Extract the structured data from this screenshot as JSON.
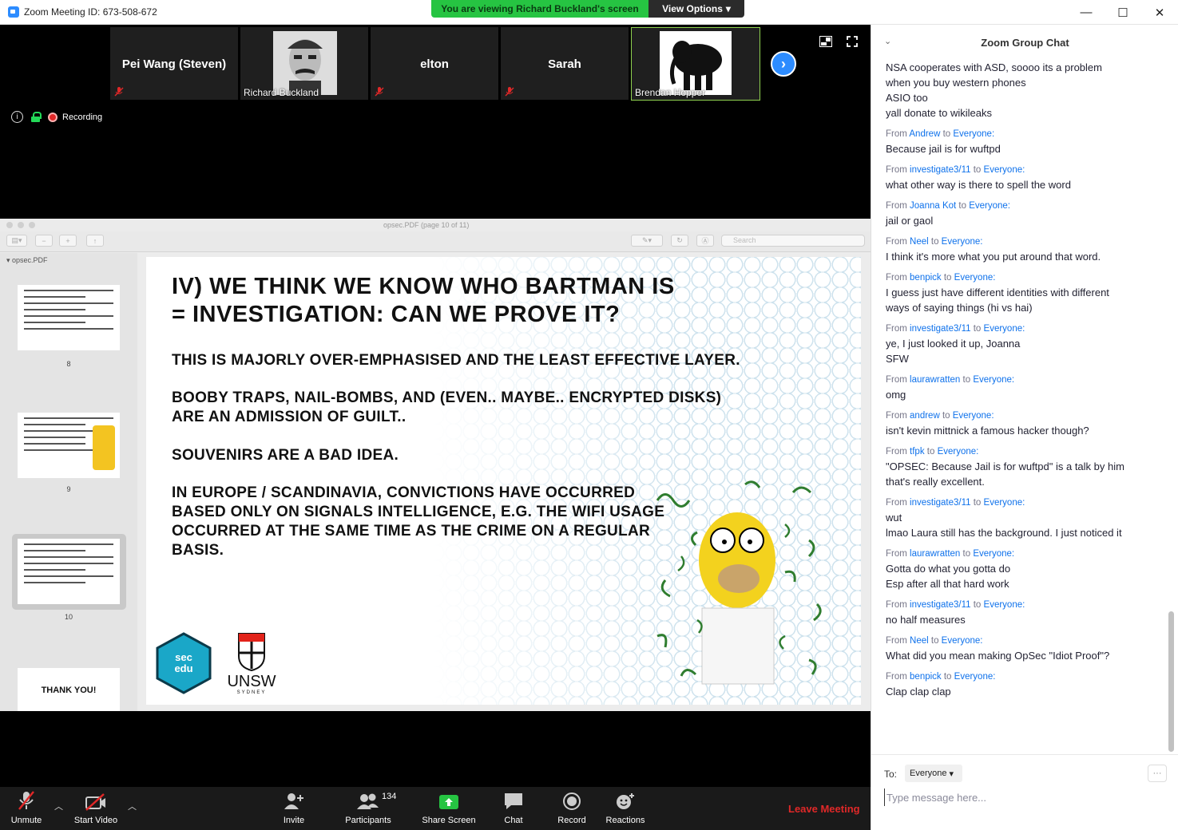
{
  "window": {
    "title": "Zoom Meeting ID: 673-508-672"
  },
  "banner": {
    "viewing": "You are viewing Richard Buckland's screen",
    "view_options": "View Options"
  },
  "participants_strip": [
    {
      "name": "Pei Wang (Steven)",
      "muted": true,
      "video": false
    },
    {
      "name": "Richard Buckland",
      "muted": false,
      "video": true
    },
    {
      "name": "elton",
      "muted": true,
      "video": false
    },
    {
      "name": "Sarah",
      "muted": true,
      "video": false
    },
    {
      "name": "Brendan Hopper",
      "muted": false,
      "video": true,
      "active": true
    }
  ],
  "status": {
    "recording": "Recording"
  },
  "pdf": {
    "title": "opsec.PDF (page 10 of 11)",
    "sidebar_file": "opsec.PDF",
    "search_placeholder": "Search",
    "thumb_pages": [
      "8",
      "9",
      "10"
    ],
    "last_thumb_text": "THANK YOU!",
    "slide": {
      "title_line1": "IV) WE THINK WE KNOW WHO BARTMAN IS",
      "title_line2": "= INVESTIGATION: CAN WE PROVE IT?",
      "p1": "THIS IS MAJORLY OVER-EMPHASISED AND THE LEAST EFFECTIVE LAYER.",
      "p2a": "BOOBY TRAPS, NAIL-BOMBS, AND (EVEN.. MAYBE.. ENCRYPTED DISKS)",
      "p2b": "ARE AN ADMISSION OF GUILT..",
      "p3": "SOUVENIRS ARE A BAD IDEA.",
      "p4a": "IN EUROPE / SCANDINAVIA, CONVICTIONS HAVE OCCURRED",
      "p4b": "BASED ONLY ON SIGNALS INTELLIGENCE, E.G. THE WIFI USAGE",
      "p4c": "OCCURRED AT THE SAME TIME AS THE CRIME ON A REGULAR",
      "p4d": "BASIS.",
      "logo_sec": "sec edu",
      "logo_unsw": "UNSW",
      "logo_unsw_sub": "SYDNEY"
    }
  },
  "toolbar": {
    "unmute": "Unmute",
    "start_video": "Start Video",
    "invite": "Invite",
    "participants": "Participants",
    "participants_count": "134",
    "share_screen": "Share Screen",
    "chat": "Chat",
    "record": "Record",
    "reactions": "Reactions",
    "leave": "Leave Meeting"
  },
  "chat": {
    "title": "Zoom Group Chat",
    "to_label": "To:",
    "to_value": "Everyone",
    "placeholder": "Type message here...",
    "intro_lines": [
      "NSA cooperates with ASD, soooo its a problem",
      "when you buy western phones",
      "ASIO too",
      "yall donate to wikileaks"
    ],
    "messages": [
      {
        "from": "Andrew",
        "to": "Everyone:",
        "lines": [
          "Because jail is for wuftpd"
        ]
      },
      {
        "from": "investigate3/11",
        "to": "Everyone:",
        "lines": [
          "what other way is there to spell the word"
        ]
      },
      {
        "from": "Joanna Kot",
        "to": "Everyone:",
        "lines": [
          "jail or gaol"
        ]
      },
      {
        "from": "Neel",
        "to": "Everyone:",
        "lines": [
          "I think it's more what you put around that word."
        ]
      },
      {
        "from": "benpick",
        "to": "Everyone:",
        "lines": [
          "I guess just have different identities with different",
          "ways of saying things (hi vs hai)"
        ]
      },
      {
        "from": "investigate3/11",
        "to": "Everyone:",
        "lines": [
          "ye, I just looked it up, Joanna",
          "SFW"
        ]
      },
      {
        "from": "laurawratten",
        "to": "Everyone:",
        "lines": [
          "omg"
        ]
      },
      {
        "from": "andrew",
        "to": "Everyone:",
        "lines": [
          "isn't kevin mittnick a famous hacker though?"
        ]
      },
      {
        "from": "tfpk",
        "to": "Everyone:",
        "lines": [
          "\"OPSEC: Because Jail is for wuftpd\" is a talk by him",
          "that's really excellent."
        ]
      },
      {
        "from": "investigate3/11",
        "to": "Everyone:",
        "lines": [
          "wut",
          "lmao Laura still has the background. I just noticed it"
        ]
      },
      {
        "from": "laurawratten",
        "to": "Everyone:",
        "lines": [
          "Gotta do what you gotta do",
          "Esp after all that hard work"
        ]
      },
      {
        "from": "investigate3/11",
        "to": "Everyone:",
        "lines": [
          "no half measures"
        ]
      },
      {
        "from": "Neel",
        "to": "Everyone:",
        "lines": [
          "What did you mean making OpSec \"Idiot Proof\"?"
        ]
      },
      {
        "from": "benpick",
        "to": "Everyone:",
        "lines": [
          "Clap clap clap"
        ]
      }
    ]
  },
  "colors": {
    "accent": "#2d8cff",
    "green": "#26c442",
    "leave": "#e02828",
    "link": "#0e71eb"
  }
}
